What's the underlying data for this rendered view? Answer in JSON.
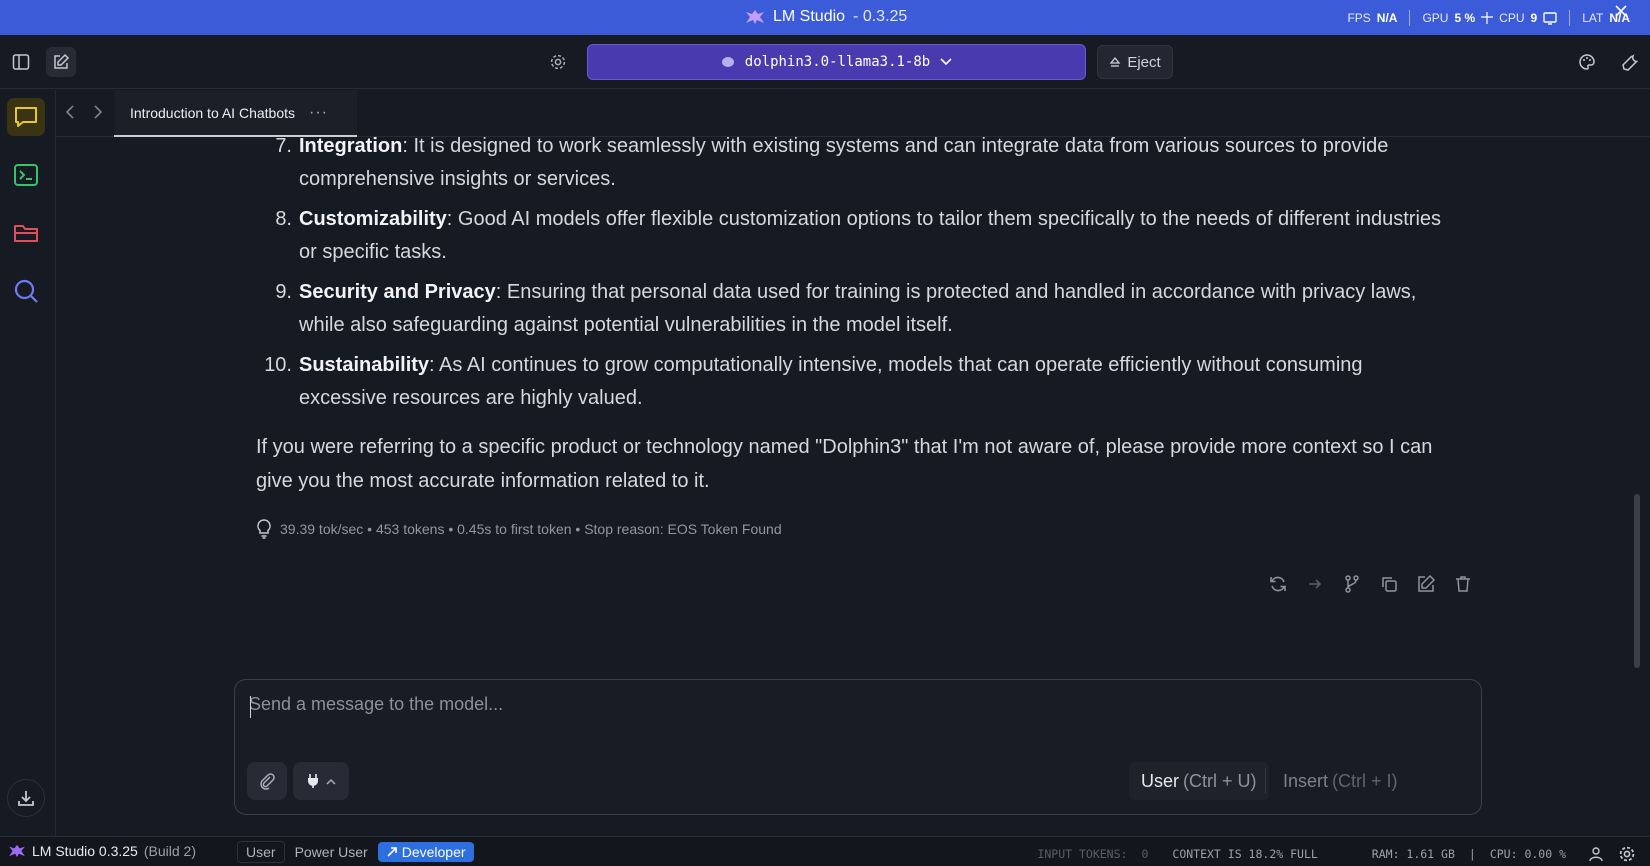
{
  "window": {
    "app_name": "LM Studio",
    "version": "- 0.3.25"
  },
  "hud": {
    "fps_label": "FPS",
    "fps_value": "N/A",
    "gpu_label": "GPU",
    "gpu_value": "5 %",
    "cpu_label": "CPU",
    "cpu_value": "9",
    "lat_label": "LAT",
    "lat_value": "N/A"
  },
  "toolbar": {
    "model_name": "dolphin3.0-llama3.1-8b",
    "eject_label": "Eject"
  },
  "tab": {
    "title": "Introduction to AI Chatbots",
    "menu_glyph": "···"
  },
  "message": {
    "items": [
      {
        "num": "7.",
        "title": "Integration",
        "text": ": It is designed to work seamlessly with existing systems and can integrate data from various sources to provide comprehensive insights or services."
      },
      {
        "num": "8.",
        "title": "Customizability",
        "text": ": Good AI models offer flexible customization options to tailor them specifically to the needs of different industries or specific tasks."
      },
      {
        "num": "9.",
        "title": "Security and Privacy",
        "text": ": Ensuring that personal data used for training is protected and handled in accordance with privacy laws, while also safeguarding against potential vulnerabilities in the model itself."
      },
      {
        "num": "10.",
        "title": "Sustainability",
        "text": ": As AI continues to grow computationally intensive, models that can operate efficiently without consuming excessive resources are highly valued."
      }
    ],
    "closing": "If you were referring to a specific product or technology named \"Dolphin3\" that I'm not aware of, please provide more context so I can give you the most accurate information related to it.",
    "stats": "39.39 tok/sec • 453 tokens • 0.45s to first token • Stop reason: EOS Token Found"
  },
  "composer": {
    "placeholder": "Send a message to the model...",
    "send_user_label": "User",
    "send_user_hint": "(Ctrl + U)",
    "insert_label": "Insert",
    "insert_hint": "(Ctrl + I)"
  },
  "statusbar": {
    "app_name": "LM Studio 0.3.25",
    "build": "(Build 2)",
    "modes": [
      "User",
      "Power User",
      "Developer"
    ],
    "input_tokens_label": "INPUT TOKENS:",
    "input_tokens_value": "0",
    "context": "CONTEXT IS 18.2% FULL",
    "ram": "RAM: 1.61 GB",
    "divider": "|",
    "cpu": "CPU: 0.00 %"
  },
  "colors": {
    "titlebar": "#3b5bd9",
    "model_select": "#4a3ab0",
    "developer_mode": "#2e6fe0",
    "chat_icon": "#e8c82a",
    "terminal_icon": "#35c26a",
    "folder_icon": "#e0505a",
    "search_icon": "#6f7cf0"
  }
}
